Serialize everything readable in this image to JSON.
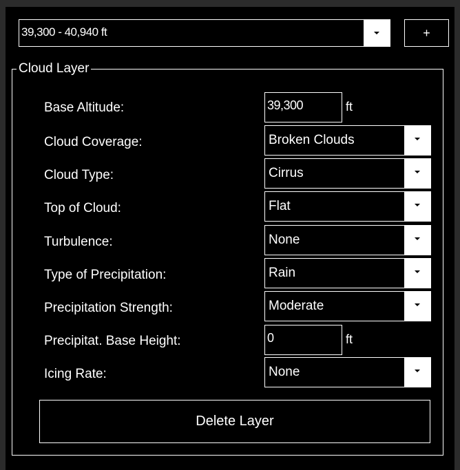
{
  "layer_selector": {
    "value": "39,300 - 40,940 ft"
  },
  "add_button": {
    "label": "+"
  },
  "group": {
    "title": "Cloud Layer"
  },
  "fields": {
    "base_altitude": {
      "label": "Base Altitude:",
      "value": "39,300",
      "unit": "ft"
    },
    "cloud_coverage": {
      "label": "Cloud Coverage:",
      "value": "Broken Clouds"
    },
    "cloud_type": {
      "label": "Cloud Type:",
      "value": "Cirrus"
    },
    "top_of_cloud": {
      "label": "Top of Cloud:",
      "value": "Flat"
    },
    "turbulence": {
      "label": "Turbulence:",
      "value": "None"
    },
    "precip_type": {
      "label": "Type of Precipitation:",
      "value": "Rain"
    },
    "precip_strength": {
      "label": "Precipitation Strength:",
      "value": "Moderate"
    },
    "precip_base": {
      "label": "Precipitat. Base Height:",
      "value": "0",
      "unit": "ft"
    },
    "icing_rate": {
      "label": "Icing Rate:",
      "value": "None"
    }
  },
  "delete_button": {
    "label": "Delete Layer"
  },
  "icons": {
    "dropdown": "chevron-down-icon"
  },
  "colors": {
    "background": "#000000",
    "foreground": "#ffffff",
    "frame": "#2b2b2b"
  }
}
